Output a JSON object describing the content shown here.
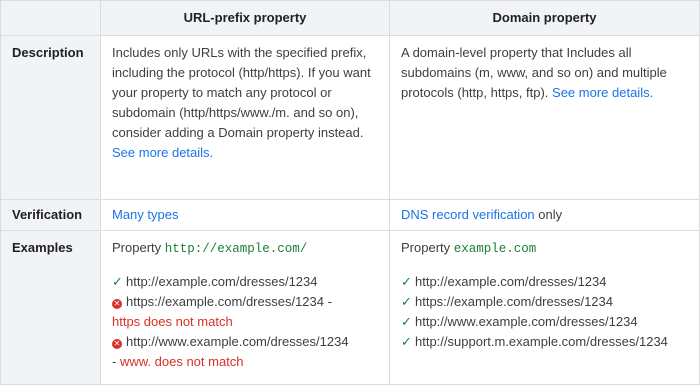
{
  "header": {
    "col_empty": "",
    "col_url_prefix": "URL-prefix property",
    "col_domain": "Domain property"
  },
  "rows": {
    "description": {
      "label": "Description",
      "url_prefix_text": "Includes only URLs with the specified prefix, including the protocol (http/https). If you want your property to match any protocol or subdomain (http/https/www./m. and so on), consider adding a Domain property instead.",
      "url_prefix_link": "See more details.",
      "domain_text": "A domain-level property that Includes all subdomains (m, www, and so on) and multiple protocols (http, https, ftp).",
      "domain_link": "See more details."
    },
    "verification": {
      "label": "Verification",
      "url_prefix_link": "Many types",
      "domain_link": "DNS record verification",
      "domain_suffix": "only"
    },
    "examples": {
      "label": "Examples",
      "url_prefix": {
        "property_label": "Property",
        "property_value": "http://example.com/",
        "lines": [
          {
            "status": "match",
            "icon": "check-icon",
            "url": "http://example.com/dresses/1234",
            "note": ""
          },
          {
            "status": "nomatch",
            "icon": "error-icon",
            "url": "https://example.com/dresses/1234",
            "sep": " -",
            "note": "https does not match"
          },
          {
            "status": "nomatch",
            "icon": "error-icon",
            "url": "http://www.example.com/dresses/1234",
            "sep": "-",
            "note": "www. does not match"
          }
        ]
      },
      "domain": {
        "property_label": "Property",
        "property_value": "example.com",
        "lines": [
          {
            "status": "match",
            "icon": "check-icon",
            "url": "http://example.com/dresses/1234"
          },
          {
            "status": "match",
            "icon": "check-icon",
            "url": "https://example.com/dresses/1234"
          },
          {
            "status": "match",
            "icon": "check-icon",
            "url": "http://www.example.com/dresses/1234"
          },
          {
            "status": "match",
            "icon": "check-icon",
            "url": "http://support.m.example.com/dresses/1234"
          }
        ]
      }
    }
  },
  "colors": {
    "header_bg": "#f1f3f4",
    "border": "#dadce0",
    "link": "#1a73e8",
    "code": "#188038",
    "check": "#188038",
    "error": "#d93025"
  }
}
